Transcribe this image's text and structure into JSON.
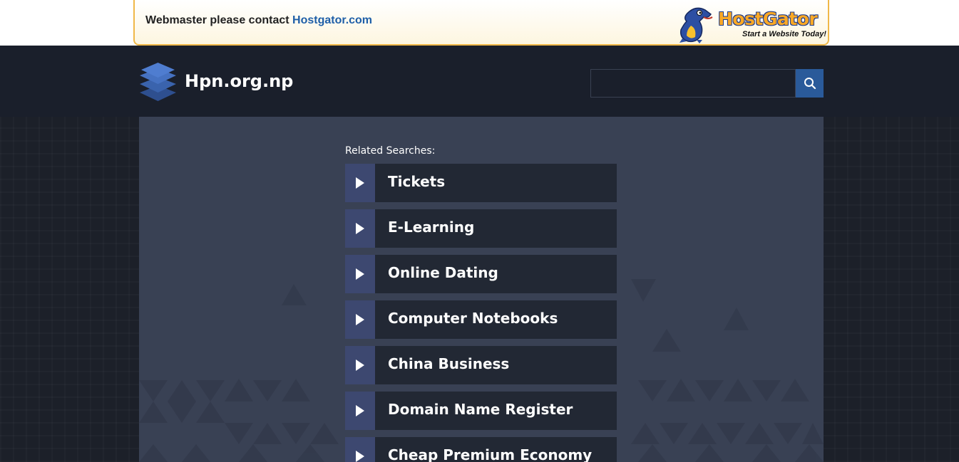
{
  "banner": {
    "message": "Webmaster please contact ",
    "link_text": "Hostgator.com",
    "logo_text": "HostGator",
    "logo_tagline": "Start a Website Today!"
  },
  "header": {
    "site_name": "Hpn.org.np",
    "search": {
      "value": "",
      "placeholder": ""
    }
  },
  "main": {
    "related_label": "Related Searches:",
    "links": [
      {
        "label": "Tickets"
      },
      {
        "label": "E-Learning"
      },
      {
        "label": "Online Dating"
      },
      {
        "label": "Computer Notebooks"
      },
      {
        "label": "China Business"
      },
      {
        "label": "Domain Name Register"
      },
      {
        "label": "Cheap Premium Economy"
      }
    ]
  },
  "colors": {
    "header_bg": "#1a1f2b",
    "panel_bg": "#394154",
    "link_bg": "#222834",
    "arrow_bg": "#3d4870",
    "search_button": "#2a5a9a",
    "banner_border": "#f0b848"
  },
  "icons": {
    "search": "search-icon",
    "site_logo": "stack-layers-icon",
    "arrow": "play-triangle-icon"
  }
}
